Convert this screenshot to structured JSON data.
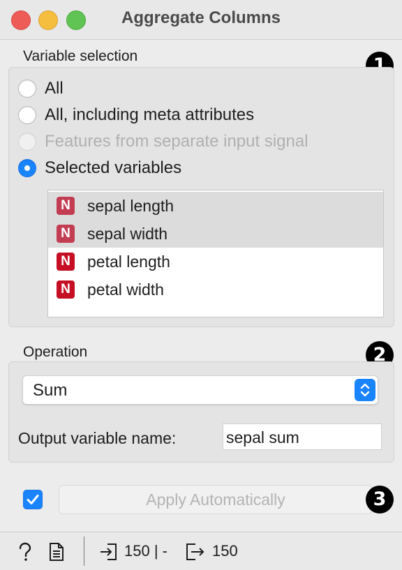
{
  "window": {
    "title": "Aggregate Columns"
  },
  "variable_selection": {
    "label": "Variable selection",
    "badge": "1",
    "options": [
      {
        "label": "All",
        "state": "unchecked"
      },
      {
        "label": "All, including meta attributes",
        "state": "unchecked"
      },
      {
        "label": "Features from separate input signal",
        "state": "disabled"
      },
      {
        "label": "Selected variables",
        "state": "checked"
      }
    ],
    "variables": [
      {
        "type_badge": "N",
        "name": "sepal length",
        "selected": true
      },
      {
        "type_badge": "N",
        "name": "sepal width",
        "selected": true
      },
      {
        "type_badge": "N",
        "name": "petal length",
        "selected": false
      },
      {
        "type_badge": "N",
        "name": "petal width",
        "selected": false
      }
    ]
  },
  "operation": {
    "label": "Operation",
    "badge": "2",
    "selected": "Sum",
    "output_label": "Output variable name:",
    "output_value": "sepal sum"
  },
  "apply": {
    "badge": "3",
    "checked": true,
    "button_label": "Apply Automatically"
  },
  "status": {
    "help_icon": "help-icon",
    "report_icon": "report-icon",
    "input_summary": "150 | -",
    "output_summary": "150"
  },
  "colors": {
    "accent": "#1a84ff",
    "numeric_badge": "#c60f25"
  }
}
